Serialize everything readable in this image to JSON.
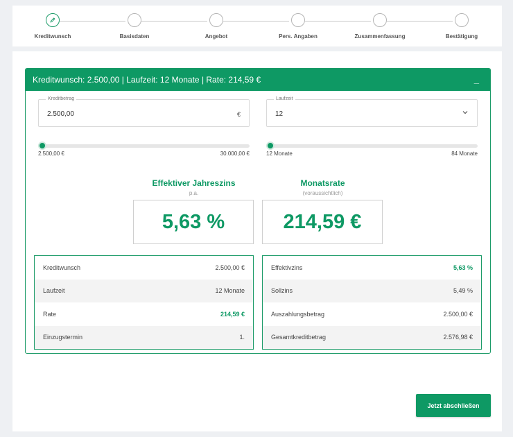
{
  "stepper": {
    "steps": [
      {
        "label": "Kreditwunsch",
        "active": true
      },
      {
        "label": "Basisdaten",
        "active": false
      },
      {
        "label": "Angebot",
        "active": false
      },
      {
        "label": "Pers. Angaben",
        "active": false
      },
      {
        "label": "Zusammenfassung",
        "active": false
      },
      {
        "label": "Bestätigung",
        "active": false
      }
    ]
  },
  "panel": {
    "header": "Kreditwunsch: 2.500,00 | Laufzeit: 12 Monate | Rate: 214,59 €",
    "collapse_glyph": "_"
  },
  "amount": {
    "legend": "Kreditbetrag",
    "value": "2.500,00",
    "suffix": "€",
    "slider_min": "2.500,00 €",
    "slider_max": "30.000,00 €",
    "slider_level": 0
  },
  "term": {
    "legend": "Laufzeit",
    "value": "12",
    "slider_min": "12 Monate",
    "slider_max": "84 Monate",
    "slider_level": 0
  },
  "kpis": {
    "rate_title": "Effektiver Jahreszins",
    "rate_sub": "p.a.",
    "rate_value": "5,63 %",
    "monthly_title": "Monatsrate",
    "monthly_sub": "(voraussichtlich)",
    "monthly_value": "214,59 €"
  },
  "summary_left": [
    {
      "label": "Kreditwunsch",
      "value": "2.500,00 €",
      "highlight": false
    },
    {
      "label": "Laufzeit",
      "value": "12 Monate",
      "highlight": false
    },
    {
      "label": "Rate",
      "value": "214,59 €",
      "highlight": true
    },
    {
      "label": "Einzugstermin",
      "value": "1.",
      "highlight": false
    }
  ],
  "summary_right": [
    {
      "label": "Effektivzins",
      "value": "5,63 %",
      "highlight": true
    },
    {
      "label": "Sollzins",
      "value": "5,49 %",
      "highlight": false
    },
    {
      "label": "Auszahlungsbetrag",
      "value": "2.500,00 €",
      "highlight": false
    },
    {
      "label": "Gesamtkreditbetrag",
      "value": "2.576,98 €",
      "highlight": false
    }
  ],
  "submit_label": "Jetzt abschließen",
  "colors": {
    "accent": "#0e9964",
    "border": "#1c9b68"
  }
}
